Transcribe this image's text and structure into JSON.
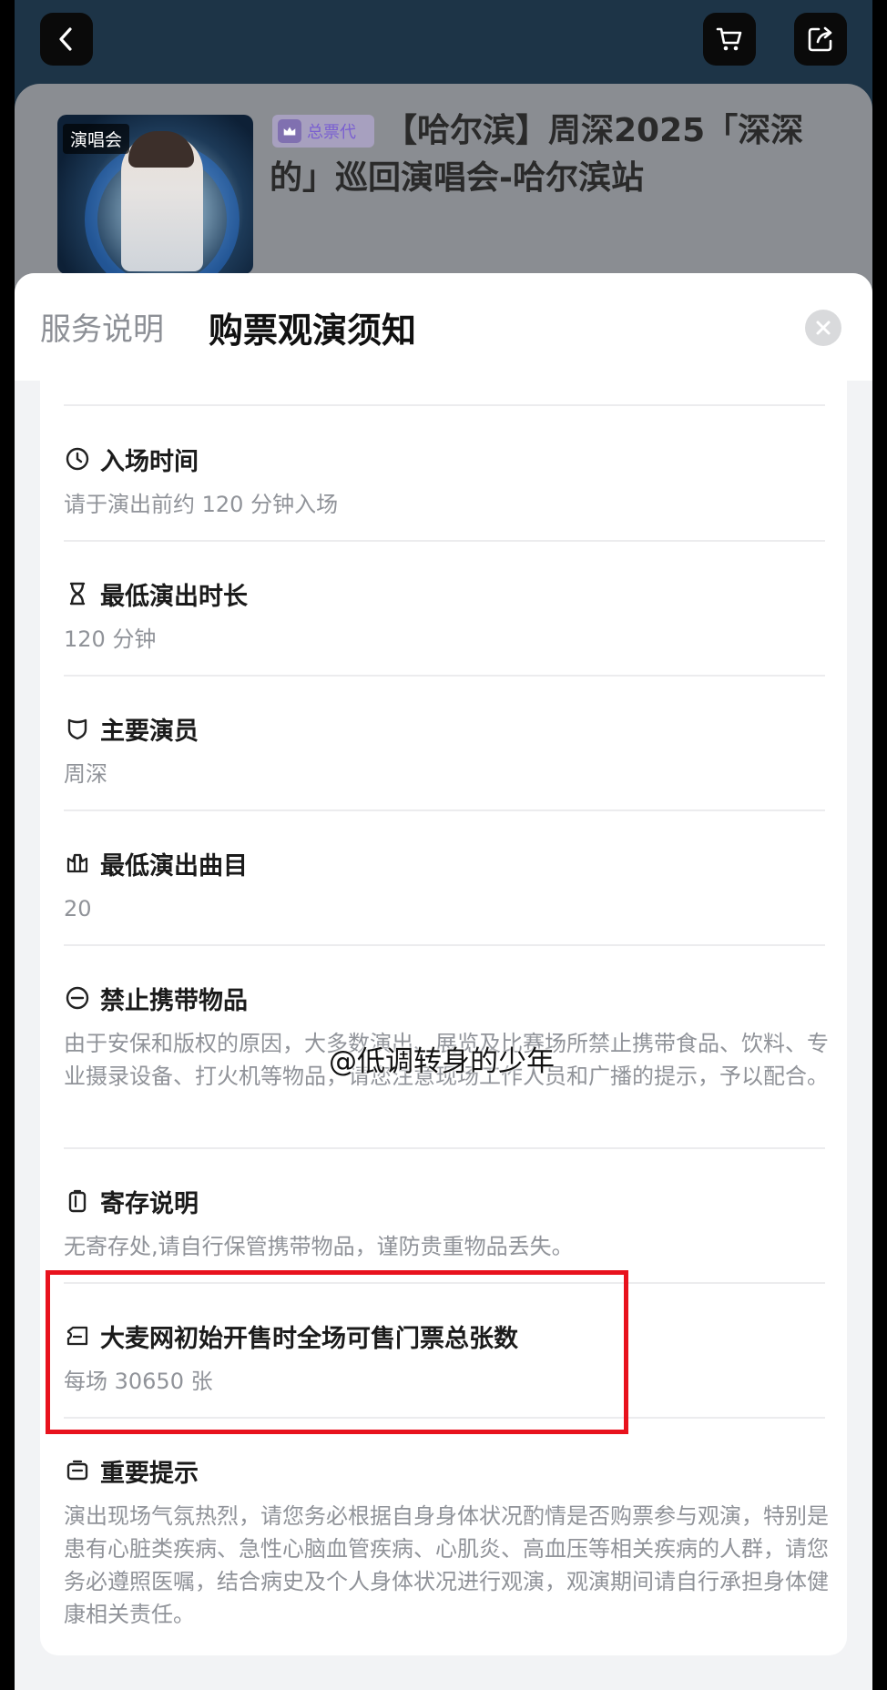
{
  "nav": {
    "back_icon": "chevron-left-icon",
    "cart_icon": "cart-icon",
    "share_icon": "share-icon"
  },
  "event": {
    "poster_tag": "演唱会",
    "badge_label": "总票代",
    "title": "【哈尔滨】周深2025「深深的」巡回演唱会-哈尔滨站"
  },
  "sheet": {
    "tab_service": "服务说明",
    "tab_notice": "购票观演须知",
    "close_icon": "close-icon"
  },
  "items": [
    {
      "icon": "clock-icon",
      "title": "入场时间",
      "body": "请于演出前约 120 分钟入场"
    },
    {
      "icon": "hourglass-icon",
      "title": "最低演出时长",
      "body": "120 分钟"
    },
    {
      "icon": "shield-icon",
      "title": "主要演员",
      "body": "周深"
    },
    {
      "icon": "crown-icon",
      "title": "最低演出曲目",
      "body": "20"
    },
    {
      "icon": "no-entry-icon",
      "title": "禁止携带物品",
      "body": "由于安保和版权的原因，大多数演出、展览及比赛场所禁止携带食品、饮料、专业摄录设备、打火机等物品，请您注意现场工作人员和广播的提示，予以配合。"
    },
    {
      "icon": "locker-icon",
      "title": "寄存说明",
      "body": "无寄存处,请自行保管携带物品，谨防贵重物品丢失。"
    },
    {
      "icon": "ticket-icon",
      "title": "大麦网初始开售时全场可售门票总张数",
      "body": "每场 30650 张"
    },
    {
      "icon": "notice-icon",
      "title": "重要提示",
      "body": "演出现场气氛热烈，请您务必根据自身身体状况酌情是否购票参与观演，特别是患有心脏类疾病、急性心脑血管疾病、心肌炎、高血压等相关疾病的人群，请您务必遵照医嘱，结合病史及个人身体状况进行观演，观演期间请自行承担身体健康相关责任。"
    }
  ],
  "watermark": "@低调转身的少年",
  "highlight_color": "#e8121d"
}
